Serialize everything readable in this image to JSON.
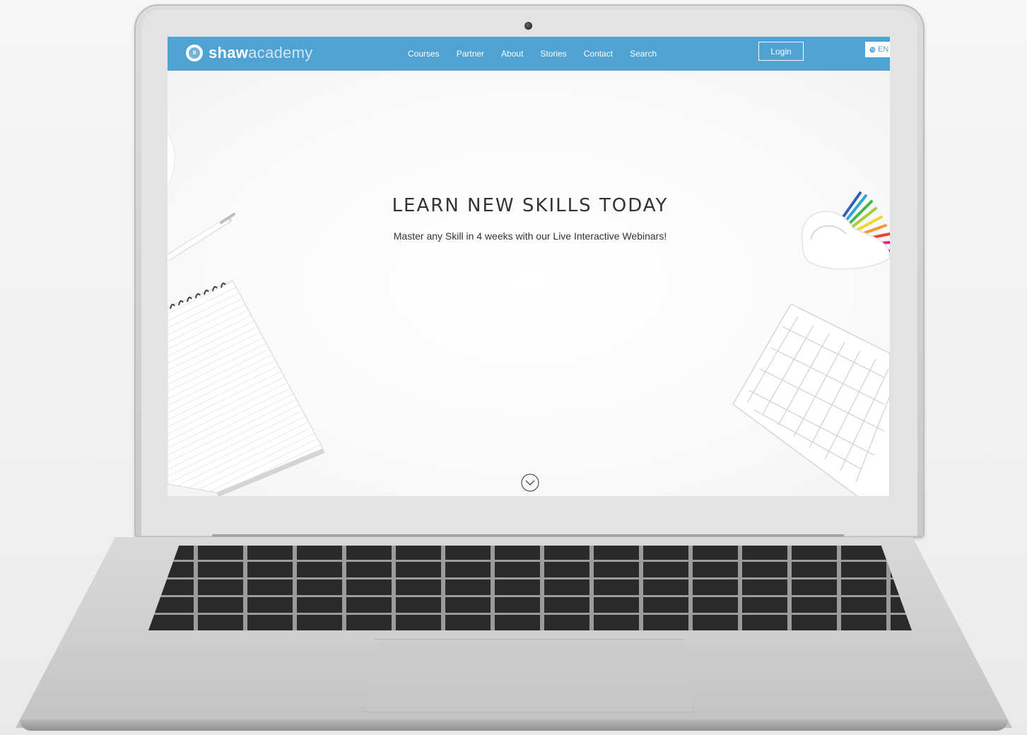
{
  "site": {
    "logo_bold": "shaw",
    "logo_light": "academy",
    "logo_mark": "s"
  },
  "nav": {
    "items": [
      {
        "label": "Courses"
      },
      {
        "label": "Partner"
      },
      {
        "label": "About"
      },
      {
        "label": "Stories"
      },
      {
        "label": "Contact"
      },
      {
        "label": "Search"
      }
    ],
    "login_label": "Login",
    "language_label": "EN",
    "language_icon": "globe-icon"
  },
  "hero": {
    "title": "LEARN NEW SKILLS TODAY",
    "subtitle": "Master any Skill in 4 weeks with our Live Interactive Webinars!",
    "scroll_icon": "chevron-down-circle-icon"
  },
  "colors": {
    "navbar": "#4fa2d1",
    "text": "#333333",
    "background": "#fcfcfc"
  }
}
